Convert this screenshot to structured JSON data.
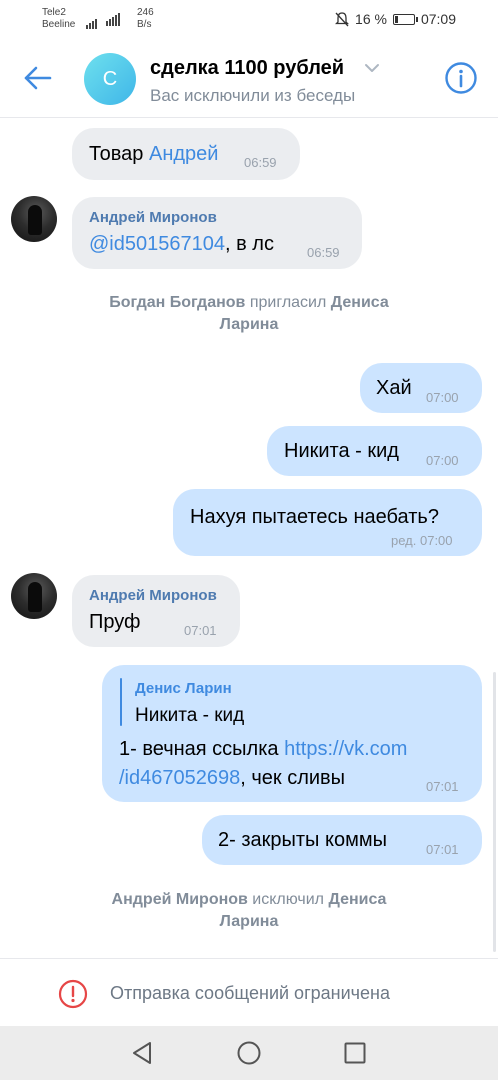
{
  "status_bar": {
    "carrier1": "Tele2",
    "carrier2": "Beeline",
    "net_speed_value": "246",
    "net_speed_unit": "B/s",
    "battery": "16 %",
    "time": "07:09",
    "battery_level": 0.16
  },
  "header": {
    "avatar_letter": "С",
    "title": "сделка 1100 рублей",
    "subtitle": "Вас исключили из беседы"
  },
  "messages": {
    "m1": {
      "text_plain": "Товар ",
      "text_link": "Андрей",
      "time": "06:59"
    },
    "m2": {
      "sender": "Андрей Миронов",
      "link": "@id501567104",
      "text": ",  в лс",
      "time": "06:59"
    },
    "sys1": {
      "actor": "Богдан Богданов",
      "action": " пригласил ",
      "target_line1": "Дениса",
      "target_line2": "Ларина"
    },
    "m3": {
      "text": "Хай",
      "time": "07:00"
    },
    "m4": {
      "text": "Никита - кид",
      "time": "07:00"
    },
    "m5": {
      "text": "Нахуя пытаетесь наебать?",
      "time": "ред. 07:00"
    },
    "m6": {
      "sender": "Андрей Миронов",
      "text": "Пруф",
      "time": "07:01"
    },
    "m7": {
      "quote_name": "Денис Ларин",
      "quote_text": "Никита - кид",
      "line1_text": "1- вечная ссылка ",
      "line1_link": "https://vk.com",
      "line2_link": "/id467052698",
      "line2_text": ", чек сливы",
      "time": "07:01"
    },
    "m8": {
      "text": "2- закрыты коммы",
      "time": "07:01"
    },
    "sys2": {
      "actor": "Андрей Миронов",
      "action": " исключил ",
      "target_line1": "Дениса",
      "target_line2": "Ларина"
    }
  },
  "footer": {
    "restricted_text": "Отправка сообщений ограничена"
  },
  "icons": {
    "back": "arrow-left-icon",
    "info": "info-icon",
    "warning": "warning-circle-icon",
    "nav_back": "triangle-back-icon",
    "nav_home": "circle-home-icon",
    "nav_recents": "square-recents-icon"
  },
  "colors": {
    "accent": "#3f8ae0",
    "incoming_bubble": "#ebedf0",
    "outgoing_bubble": "#cce4ff",
    "sender_name": "#4f7bb0",
    "warning_red": "#e64646"
  }
}
